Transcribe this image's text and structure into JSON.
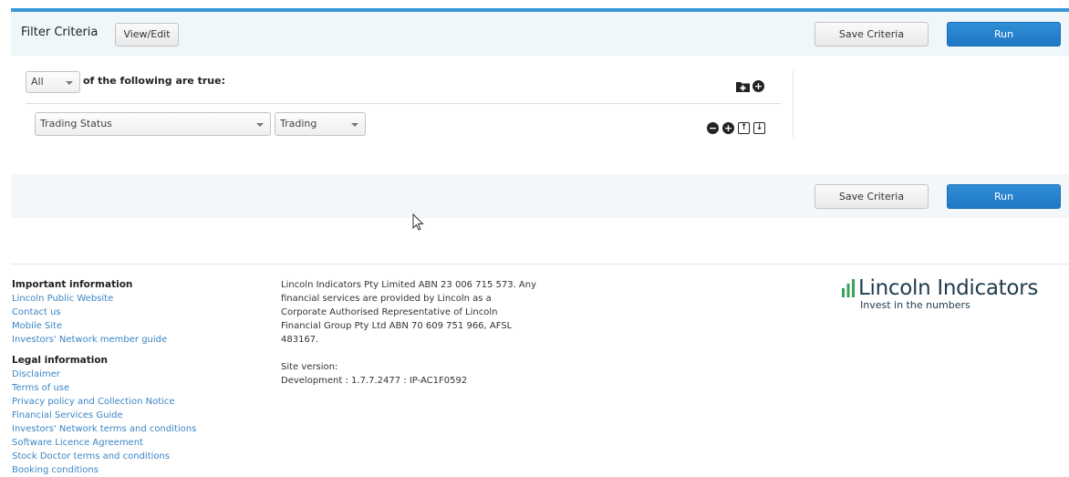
{
  "filter": {
    "title": "Filter Criteria",
    "view_edit_label": "View/Edit",
    "save_label": "Save Criteria",
    "run_label": "Run",
    "match_select_value": "All",
    "match_suffix": "of the following are true:",
    "rule": {
      "field_value": "Trading Status",
      "value_value": "Trading"
    }
  },
  "icons": {
    "add_group": "folder-plus-icon",
    "add_rule": "plus-circle-icon",
    "remove": "minus-circle-icon",
    "add": "plus-circle-icon",
    "move_up": "arrow-up-icon",
    "move_down": "arrow-down-icon"
  },
  "footer": {
    "important_heading": "Important information",
    "important_links": [
      "Lincoln Public Website",
      "Contact us",
      "Mobile Site",
      "Investors' Network member guide"
    ],
    "legal_heading": "Legal information",
    "legal_links": [
      "Disclaimer",
      "Terms of use",
      "Privacy policy and Collection Notice",
      "Financial Services Guide",
      "Investors' Network terms and conditions",
      "Software Licence Agreement",
      "Stock Doctor terms and conditions",
      "Booking conditions"
    ],
    "company_text": [
      "Lincoln Indicators Pty Limited ABN 23 006 715 573. Any",
      "financial services are provided by Lincoln as a",
      "Corporate Authorised Representative of Lincoln",
      "Financial Group Pty Ltd ABN 70 609 751 966, AFSL",
      "483167."
    ],
    "site_version_label": "Site version:",
    "site_version_value": "Development : 1.7.7.2477 : IP-AC1F0592"
  },
  "logo": {
    "name": "Lincoln Indicators",
    "tagline": "Invest in the numbers"
  },
  "colors": {
    "accent": "#3a98d8",
    "run_button": "#2584cf",
    "link": "#3a86c6",
    "logo_green": "#3aa35a"
  }
}
